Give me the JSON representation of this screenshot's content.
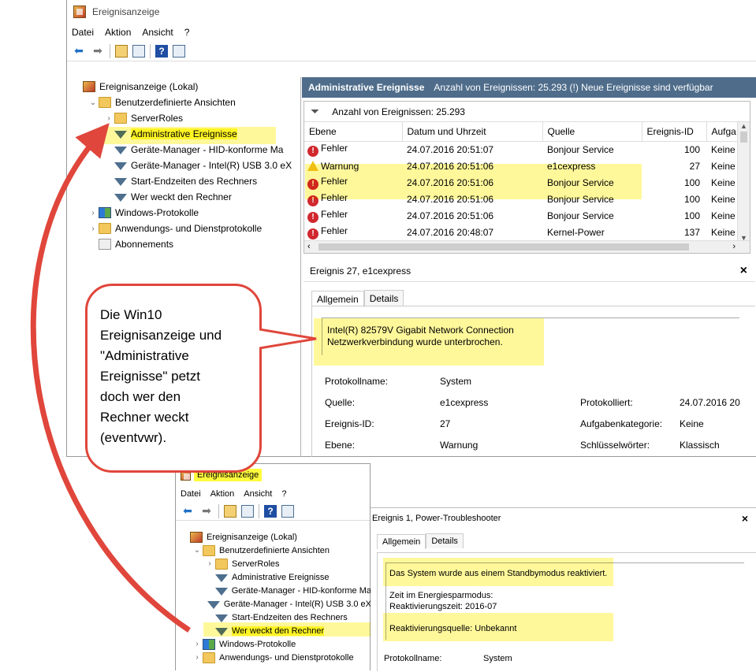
{
  "top": {
    "title": "Ereignisanzeige",
    "menu": [
      "Datei",
      "Aktion",
      "Ansicht",
      "?"
    ],
    "tree": [
      {
        "label": "Ereignisanzeige (Lokal)",
        "level": 0,
        "icon": "event-viewer-icon",
        "twisty": ""
      },
      {
        "label": "Benutzerdefinierte Ansichten",
        "level": 1,
        "icon": "folder-open-icon",
        "twisty": "⌄"
      },
      {
        "label": "ServerRoles",
        "level": 2,
        "icon": "folder-icon",
        "twisty": "›"
      },
      {
        "label": "Administrative Ereignisse",
        "level": 2,
        "icon": "filter-icon",
        "twisty": "",
        "highlight": true
      },
      {
        "label": "Geräte-Manager - HID-konforme Ma",
        "level": 2,
        "icon": "filter-icon",
        "twisty": ""
      },
      {
        "label": "Geräte-Manager - Intel(R) USB 3.0 eX",
        "level": 2,
        "icon": "filter-icon",
        "twisty": ""
      },
      {
        "label": "Start-Endzeiten des Rechners",
        "level": 2,
        "icon": "filter-icon",
        "twisty": ""
      },
      {
        "label": "Wer weckt den Rechner",
        "level": 2,
        "icon": "filter-icon",
        "twisty": ""
      },
      {
        "label": "Windows-Protokolle",
        "level": 1,
        "icon": "windows-logs-icon",
        "twisty": "›"
      },
      {
        "label": "Anwendungs- und Dienstprotokolle",
        "level": 1,
        "icon": "folder-icon",
        "twisty": "›"
      },
      {
        "label": "Abonnements",
        "level": 1,
        "icon": "subscriptions-icon",
        "twisty": ""
      }
    ],
    "header": {
      "title": "Administrative Ereignisse",
      "info": "Anzahl von Ereignissen: 25.293 (!) Neue Ereignisse sind verfügbar"
    },
    "filter_text": "Anzahl von Ereignissen: 25.293",
    "columns": [
      "Ebene",
      "Datum und Uhrzeit",
      "Quelle",
      "Ereignis-ID",
      "Aufga"
    ],
    "rows": [
      {
        "level": "Fehler",
        "type": "error",
        "date": "24.07.2016 20:51:07",
        "source": "Bonjour Service",
        "id": "100",
        "task": "Keine"
      },
      {
        "level": "Warnung",
        "type": "warning",
        "date": "24.07.2016 20:51:06",
        "source": "e1cexpress",
        "id": "27",
        "task": "Keine"
      },
      {
        "level": "Fehler",
        "type": "error",
        "date": "24.07.2016 20:51:06",
        "source": "Bonjour Service",
        "id": "100",
        "task": "Keine"
      },
      {
        "level": "Fehler",
        "type": "error",
        "date": "24.07.2016 20:51:06",
        "source": "Bonjour Service",
        "id": "100",
        "task": "Keine"
      },
      {
        "level": "Fehler",
        "type": "error",
        "date": "24.07.2016 20:51:06",
        "source": "Bonjour Service",
        "id": "100",
        "task": "Keine"
      },
      {
        "level": "Fehler",
        "type": "error",
        "date": "24.07.2016 20:48:07",
        "source": "Kernel-Power",
        "id": "137",
        "task": "Keine"
      }
    ],
    "detail": {
      "title": "Ereignis 27, e1cexpress",
      "tabs": [
        "Allgemein",
        "Details"
      ],
      "message_line1": "Intel(R) 82579V Gigabit Network Connection",
      "message_line2": "Netzwerkverbindung wurde unterbrochen.",
      "fields": {
        "protokollname_label": "Protokollname:",
        "protokollname": "System",
        "quelle_label": "Quelle:",
        "quelle": "e1cexpress",
        "protokolliert_label": "Protokolliert:",
        "protokolliert": "24.07.2016 20",
        "eid_label": "Ereignis-ID:",
        "eid": "27",
        "aufgabe_label": "Aufgabenkategorie:",
        "aufgabe": "Keine",
        "ebene_label": "Ebene:",
        "ebene": "Warnung",
        "schluessel_label": "Schlüsselwörter:",
        "schluessel": "Klassisch"
      }
    }
  },
  "callout": {
    "lines": [
      "Die Win10",
      "Ereignisanzeige und",
      "\"Administrative",
      "Ereignisse\"  petzt",
      "doch wer den",
      "Rechner weckt",
      "(eventvwr)."
    ]
  },
  "bottom": {
    "title": "Ereignisanzeige",
    "menu": [
      "Datei",
      "Aktion",
      "Ansicht",
      "?"
    ],
    "tree": [
      {
        "label": "Ereignisanzeige (Lokal)",
        "level": 0,
        "icon": "event-viewer-icon",
        "twisty": ""
      },
      {
        "label": "Benutzerdefinierte Ansichten",
        "level": 1,
        "icon": "folder-open-icon",
        "twisty": "⌄"
      },
      {
        "label": "ServerRoles",
        "level": 2,
        "icon": "folder-icon",
        "twisty": "›"
      },
      {
        "label": "Administrative Ereignisse",
        "level": 2,
        "icon": "filter-icon",
        "twisty": ""
      },
      {
        "label": "Geräte-Manager - HID-konforme Ma",
        "level": 2,
        "icon": "filter-icon",
        "twisty": ""
      },
      {
        "label": "Geräte-Manager - Intel(R) USB 3.0 eX",
        "level": 2,
        "icon": "filter-icon",
        "twisty": ""
      },
      {
        "label": "Start-Endzeiten des Rechners",
        "level": 2,
        "icon": "filter-icon",
        "twisty": ""
      },
      {
        "label": "Wer weckt den Rechner",
        "level": 2,
        "icon": "filter-icon",
        "twisty": "",
        "highlight": true
      },
      {
        "label": "Windows-Protokolle",
        "level": 1,
        "icon": "windows-logs-icon",
        "twisty": "›"
      },
      {
        "label": "Anwendungs- und Dienstprotokolle",
        "level": 1,
        "icon": "folder-icon",
        "twisty": "›"
      }
    ],
    "detail": {
      "title": "Ereignis 1, Power-Troubleshooter",
      "tabs": [
        "Allgemein",
        "Details"
      ],
      "msg1": "Das System wurde aus einem Standbymodus reaktiviert.",
      "msg2": "Zeit im Energiesparmodus:",
      "msg3": "Reaktivierungszeit: 2016-07",
      "msg4": "Reaktivierungsquelle: Unbekannt",
      "protokollname_label": "Protokollname:",
      "protokollname": "System"
    }
  },
  "colors": {
    "highlight": "#fffb3d",
    "arrow": "#e0463b",
    "header": "#4f6d8b"
  }
}
